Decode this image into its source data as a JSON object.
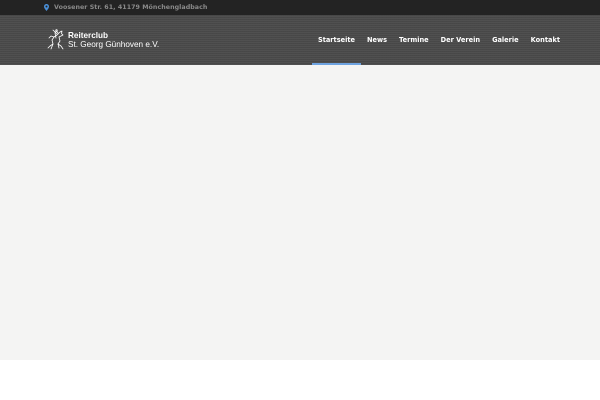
{
  "topbar": {
    "address": "Voosener Str. 61, 41179 Mönchengladbach",
    "icon": "map-pin-icon"
  },
  "header": {
    "logo": {
      "line1": "Reiterclub",
      "line2": "St. Georg Günhoven e.V.",
      "icon": "horse-rider-icon"
    },
    "nav": [
      {
        "label": "Startseite",
        "active": true
      },
      {
        "label": "News"
      },
      {
        "label": "Termine"
      },
      {
        "label": "Der Verein"
      },
      {
        "label": "Galerie"
      },
      {
        "label": "Kontakt"
      }
    ]
  },
  "colors": {
    "topbar_bg": "#232323",
    "header_bg": "#4a4a4a",
    "active_accent": "#6ea3e0",
    "hero_bg": "#f4f4f3"
  }
}
